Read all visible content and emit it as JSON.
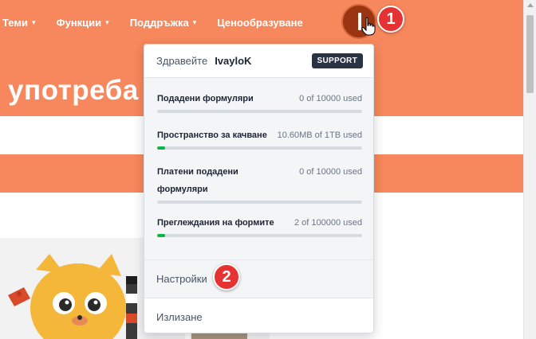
{
  "nav": {
    "items": [
      {
        "label": "Теми",
        "caret": "▾"
      },
      {
        "label": "Функции",
        "caret": "▾"
      },
      {
        "label": "Поддръжка",
        "caret": "▾"
      },
      {
        "label": "Ценообразуване",
        "caret": ""
      }
    ]
  },
  "hero": {
    "title": "употреба"
  },
  "colors": {
    "accent": "#f7875c",
    "support_badge": "#2a3346",
    "progress": "#0fb347",
    "step_badge": "#e53232"
  },
  "account_menu": {
    "greeting": "Здравейте",
    "username": "IvayloK",
    "support_label": "SUPPORT",
    "usage": [
      {
        "label": "Подадени формуляри",
        "value": "0 of 10000 used",
        "fraction": 0.0
      },
      {
        "label": "Пространство за качване",
        "value": "10.60MB of 1TB used",
        "fraction": 0.04
      },
      {
        "label": "Платени подадени формуляри",
        "value": "0 of 10000 used",
        "fraction": 0.0
      },
      {
        "label": "Преглеждания на формите",
        "value": "2 of 100000 used",
        "fraction": 0.04
      }
    ],
    "settings_label": "Настройки",
    "logout_label": "Излизане"
  },
  "annotations": {
    "step1": "1",
    "step2": "2"
  },
  "icons": {
    "avatar": "user-avatar-icon",
    "cursor": "hand-pointer-icon"
  }
}
